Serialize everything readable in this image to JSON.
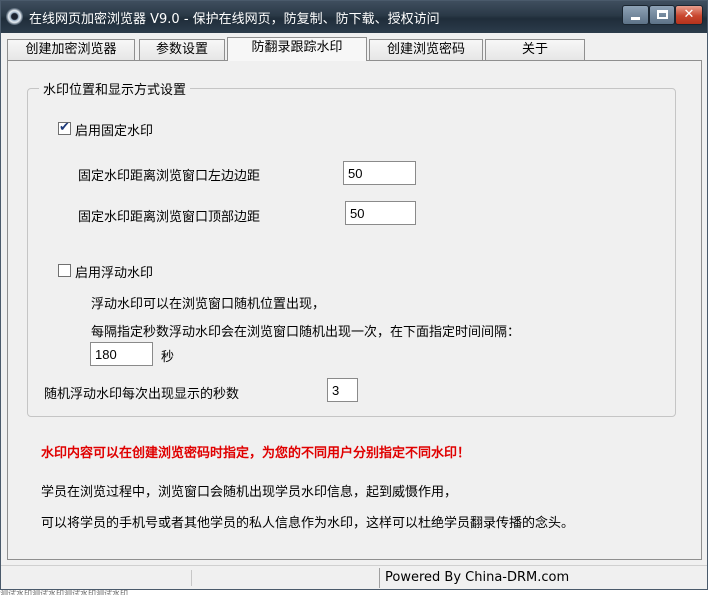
{
  "window": {
    "title": "在线网页加密浏览器 V9.0 -  保护在线网页，防复制、防下载、授权访问",
    "controls": {
      "minimize": "minimize",
      "maximize": "maximize",
      "close": "✕"
    }
  },
  "tabs": [
    {
      "label": "创建加密浏览器"
    },
    {
      "label": "参数设置"
    },
    {
      "label": "防翻录跟踪水印"
    },
    {
      "label": "创建浏览密码"
    },
    {
      "label": "关于"
    }
  ],
  "active_tab": 2,
  "group": {
    "legend": "水印位置和显示方式设置",
    "fixed": {
      "label": "启用固定水印",
      "checked": true,
      "left_label": "固定水印距离浏览窗口左边边距",
      "left_value": "50",
      "top_label": "固定水印距离浏览窗口顶部边距",
      "top_value": "50"
    },
    "floating": {
      "label": "启用浮动水印",
      "checked": false,
      "desc1": "浮动水印可以在浏览窗口随机位置出现，",
      "desc2": "每隔指定秒数浮动水印会在浏览窗口随机出现一次，在下面指定时间间隔：",
      "interval_value": "180",
      "interval_unit": "秒"
    },
    "duration": {
      "label": "随机浮动水印每次出现显示的秒数",
      "value": "3"
    }
  },
  "warning": "水印内容可以在创建浏览密码时指定，为您的不同用户分别指定不同水印！",
  "info": {
    "line1": "学员在浏览过程中，浏览窗口会随机出现学员水印信息，起到威慑作用，",
    "line2": "可以将学员的手机号或者其他学员的私人信息作为水印，这样可以杜绝学员翻录传播的念头。"
  },
  "status": {
    "powered_by": "Powered By China-DRM.com",
    "overflow_text": "测试水印测试水印测试水印测试水印"
  },
  "colors": {
    "warning": "#e00000",
    "titlebar": "#2a3947",
    "close_button": "#c9462e"
  }
}
